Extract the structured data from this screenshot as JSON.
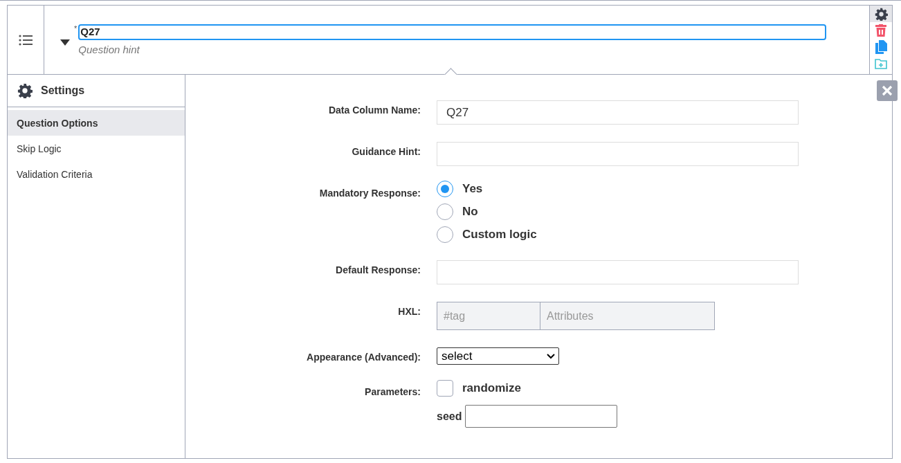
{
  "question": {
    "required_mark": "*",
    "label": "Q27",
    "hint": "Question hint",
    "expanded": true
  },
  "settings": {
    "title": "Settings"
  },
  "tabs": [
    {
      "label": "Question Options",
      "selected": true
    },
    {
      "label": "Skip Logic",
      "selected": false
    },
    {
      "label": "Validation Criteria",
      "selected": false
    }
  ],
  "fields": [
    {
      "kind": "text",
      "label": "Data Column Name:",
      "value": "Q27"
    },
    {
      "kind": "text",
      "label": "Guidance Hint:"
    },
    {
      "kind": "radio",
      "label": "Mandatory Response:",
      "options": [
        {
          "label": "Yes",
          "selected": true
        },
        {
          "label": "No",
          "selected": false
        },
        {
          "label": "Custom logic",
          "selected": false
        }
      ]
    },
    {
      "kind": "text",
      "label": "Default Response:"
    },
    {
      "kind": "hxl",
      "label": "HXL:",
      "tag_placeholder": "#tag",
      "attributes_placeholder": "Attributes"
    },
    {
      "kind": "select",
      "label": "Appearance (Advanced):",
      "value": "select"
    },
    {
      "kind": "params",
      "label": "Parameters:",
      "checkbox_label": "randomize",
      "checked": false,
      "seed_label": "seed"
    }
  ]
}
